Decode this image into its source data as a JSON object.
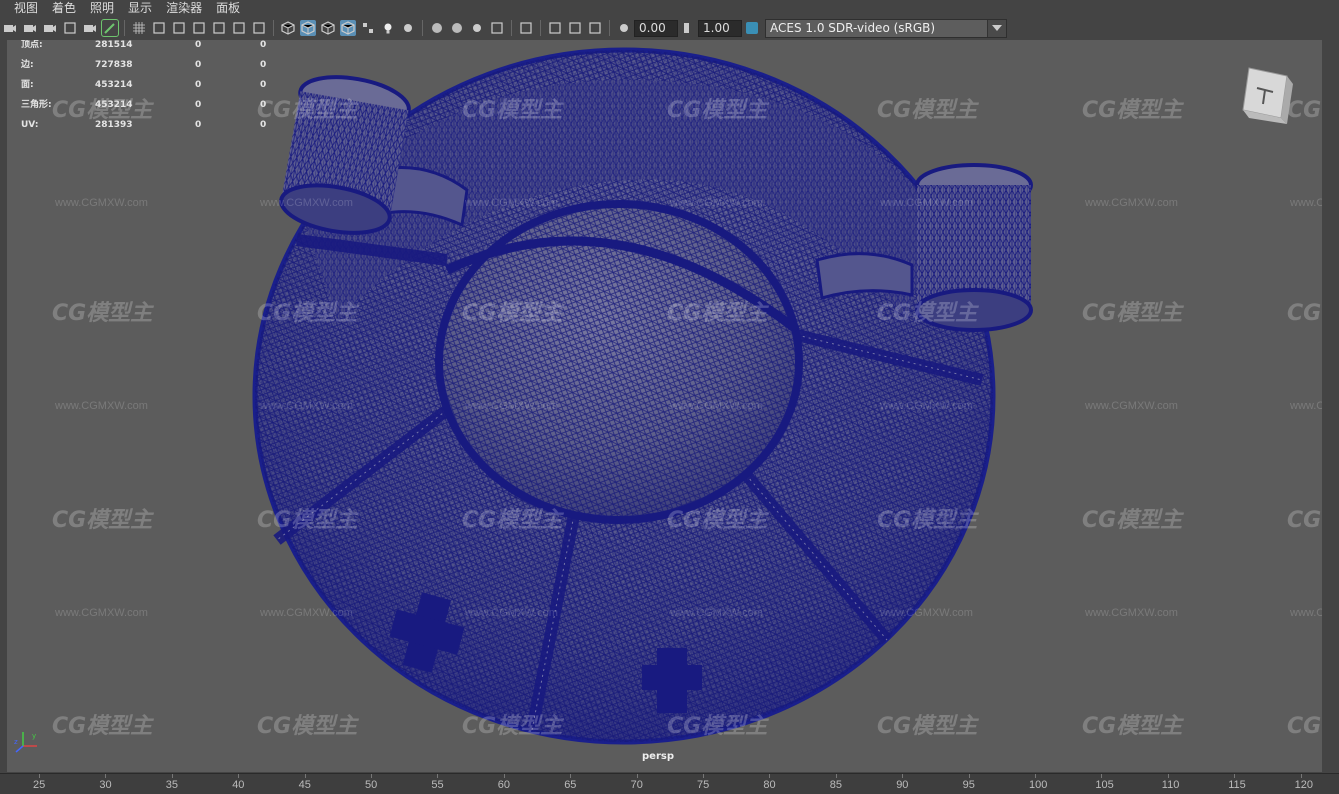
{
  "menubar": {
    "items": [
      "视图",
      "着色",
      "照明",
      "显示",
      "渲染器",
      "面板"
    ]
  },
  "toolbar": {
    "field_a": "0.00",
    "field_b": "1.00",
    "color_space": "ACES 1.0 SDR-video (sRGB)",
    "icons": [
      "select-camera-icon",
      "camera-attributes-icon",
      "bookmark-icon",
      "image-plane-icon",
      "grid-icon",
      "film-gate-icon",
      "resolution-gate-icon",
      "gate-mask-icon",
      "field-chart-icon",
      "safe-action-icon",
      "safe-title-icon",
      "wireframe-icon",
      "smooth-shade-icon",
      "wireframe-on-shaded-icon",
      "textured-icon",
      "lights-icon",
      "shadows-icon",
      "screen-space-ao-icon",
      "motion-blur-icon",
      "multisample-aa-icon",
      "depth-of-field-icon",
      "isolate-select-icon",
      "xray-icon",
      "xray-joints-icon",
      "backface-culling-icon",
      "exposure-icon",
      "gamma-icon",
      "color-management-icon"
    ]
  },
  "hud": {
    "rows": [
      {
        "label": "顶点:",
        "value": "281514",
        "a": "0",
        "b": "0"
      },
      {
        "label": "边:",
        "value": "727838",
        "a": "0",
        "b": "0"
      },
      {
        "label": "面:",
        "value": "453214",
        "a": "0",
        "b": "0"
      },
      {
        "label": "三角形:",
        "value": "453214",
        "a": "0",
        "b": "0"
      },
      {
        "label": "UV:",
        "value": "281393",
        "a": "0",
        "b": "0"
      }
    ]
  },
  "viewport": {
    "camera_label": "persp",
    "mesh_color": "#1a1f8c",
    "background": "#5c5c5c",
    "watermark_text": "CG模型主",
    "watermark_url": "www.CGMXW.com"
  },
  "timeline": {
    "ticks": [
      "25",
      "30",
      "35",
      "40",
      "45",
      "50",
      "55",
      "60",
      "65",
      "70",
      "75",
      "80",
      "85",
      "90",
      "95",
      "100",
      "105",
      "110",
      "115",
      "120"
    ]
  }
}
